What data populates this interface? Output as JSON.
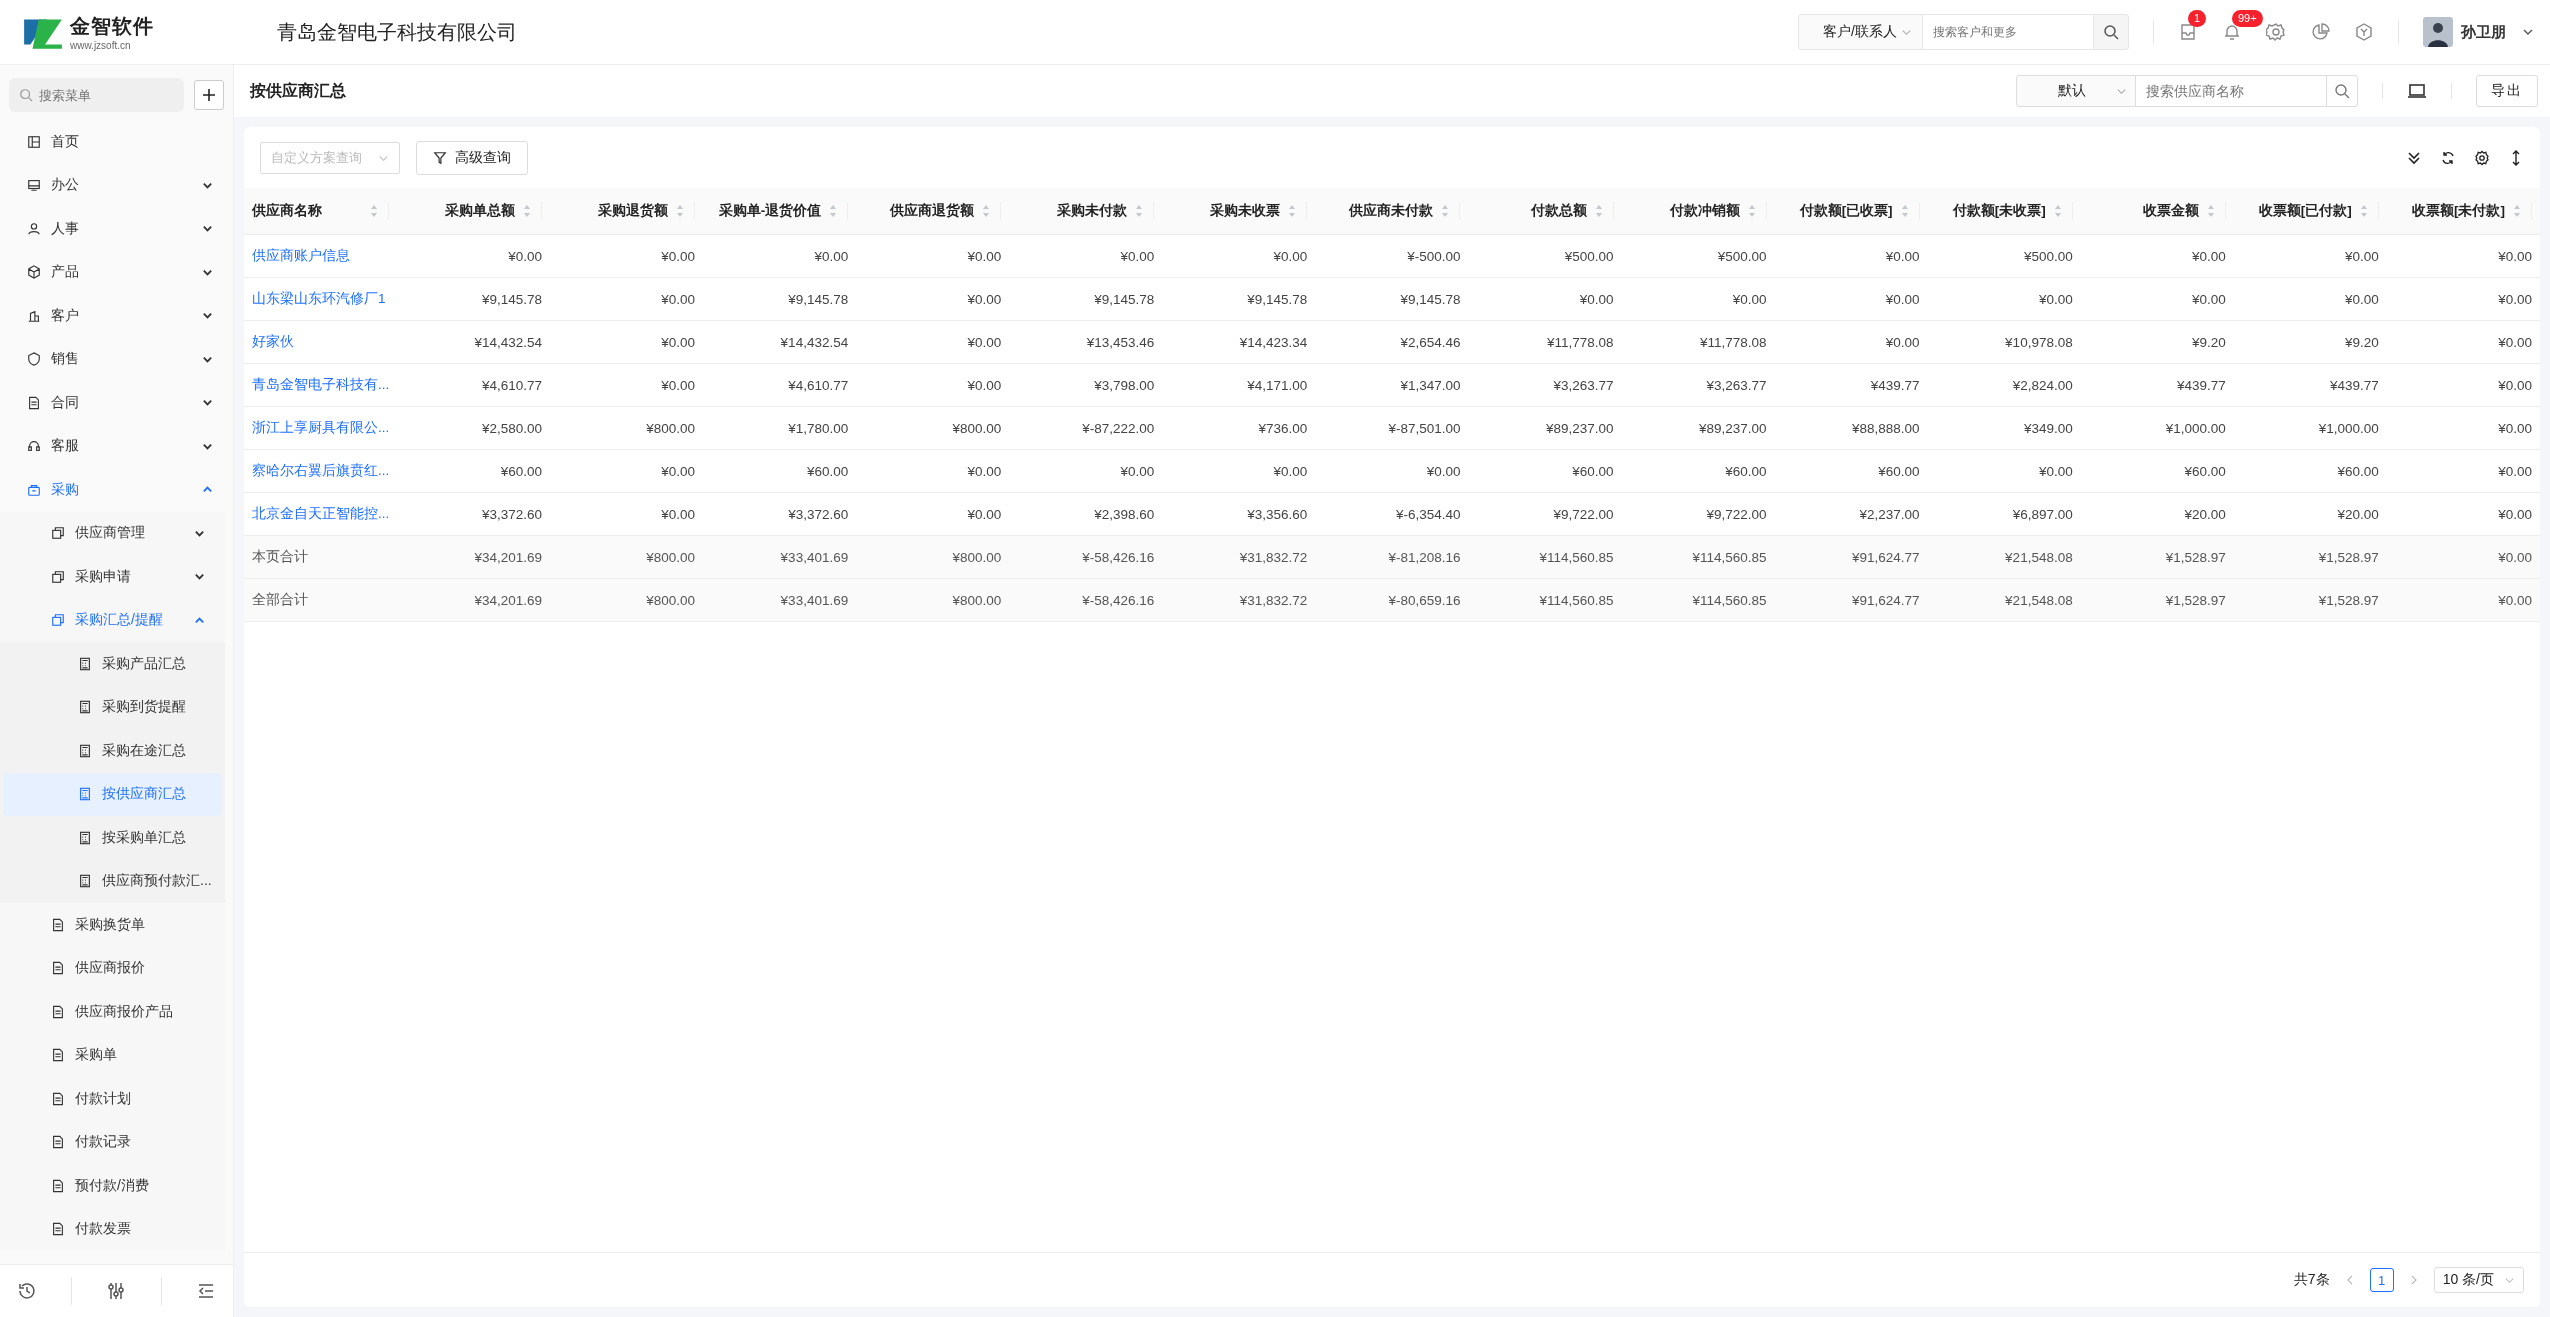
{
  "header": {
    "logo": {
      "name": "金智软件",
      "url": "www.jzsoft.cn"
    },
    "company": "青岛金智电子科技有限公司",
    "search": {
      "scope": "客户/联系人",
      "placeholder": "搜索客户和更多"
    },
    "badges": [
      "1",
      "99+"
    ],
    "user": "孙卫朋"
  },
  "sidebar": {
    "search": {
      "placeholder": "搜索菜单"
    },
    "items": [
      {
        "label": "首页",
        "kind": "link",
        "selected": false
      },
      {
        "label": "办公",
        "kind": "group",
        "expanded": false,
        "selected": false
      },
      {
        "label": "人事",
        "kind": "group",
        "expanded": false,
        "selected": false
      },
      {
        "label": "产品",
        "kind": "group",
        "expanded": false,
        "selected": false
      },
      {
        "label": "客户",
        "kind": "group",
        "expanded": false,
        "selected": false
      },
      {
        "label": "销售",
        "kind": "group",
        "expanded": false,
        "selected": false
      },
      {
        "label": "合同",
        "kind": "group",
        "expanded": false,
        "selected": false
      },
      {
        "label": "客服",
        "kind": "group",
        "expanded": false,
        "selected": false
      },
      {
        "label": "采购",
        "kind": "group",
        "expanded": true,
        "selected": false,
        "children": [
          {
            "label": "供应商管理",
            "kind": "group",
            "expanded": false,
            "selected": false
          },
          {
            "label": "采购申请",
            "kind": "group",
            "expanded": false,
            "selected": false
          },
          {
            "label": "采购汇总/提醒",
            "kind": "group",
            "expanded": true,
            "selected": false,
            "children": [
              {
                "label": "采购产品汇总",
                "kind": "link",
                "selected": false
              },
              {
                "label": "采购到货提醒",
                "kind": "link",
                "selected": false
              },
              {
                "label": "采购在途汇总",
                "kind": "link",
                "selected": false
              },
              {
                "label": "按供应商汇总",
                "kind": "link",
                "selected": true
              },
              {
                "label": "按采购单汇总",
                "kind": "link",
                "selected": false
              },
              {
                "label": "供应商预付款汇...",
                "kind": "link",
                "selected": false
              }
            ]
          },
          {
            "label": "采购换货单",
            "kind": "link",
            "selected": false
          },
          {
            "label": "供应商报价",
            "kind": "link",
            "selected": false
          },
          {
            "label": "供应商报价产品",
            "kind": "link",
            "selected": false
          },
          {
            "label": "采购单",
            "kind": "link",
            "selected": false
          },
          {
            "label": "付款计划",
            "kind": "link",
            "selected": false
          },
          {
            "label": "付款记录",
            "kind": "link",
            "selected": false
          },
          {
            "label": "预付款/消费",
            "kind": "link",
            "selected": false
          },
          {
            "label": "付款发票",
            "kind": "link",
            "selected": false
          }
        ]
      }
    ]
  },
  "page": {
    "title": "按供应商汇总",
    "view": "默认",
    "search": {
      "placeholder": "搜索供应商名称"
    },
    "export": "导出"
  },
  "filters": {
    "scheme": {
      "placeholder": "自定义方案查询"
    },
    "advanced": "高级查询"
  },
  "table": {
    "columns": [
      "供应商名称",
      "采购单总额",
      "采购退货额",
      "采购单-退货价值",
      "供应商退货额",
      "采购未付款",
      "采购未收票",
      "供应商未付款",
      "付款总额",
      "付款冲销额",
      "付款额[已收票]",
      "付款额[未收票]",
      "收票金额",
      "收票额[已付款]",
      "收票额[未付款]"
    ],
    "rows": [
      {
        "kind": "supplier",
        "cells": [
          "供应商账户信息",
          "¥0.00",
          "¥0.00",
          "¥0.00",
          "¥0.00",
          "¥0.00",
          "¥0.00",
          "¥-500.00",
          "¥500.00",
          "¥500.00",
          "¥0.00",
          "¥500.00",
          "¥0.00",
          "¥0.00",
          "¥0.00"
        ]
      },
      {
        "kind": "supplier",
        "cells": [
          "山东梁山东环汽修厂1",
          "¥9,145.78",
          "¥0.00",
          "¥9,145.78",
          "¥0.00",
          "¥9,145.78",
          "¥9,145.78",
          "¥9,145.78",
          "¥0.00",
          "¥0.00",
          "¥0.00",
          "¥0.00",
          "¥0.00",
          "¥0.00",
          "¥0.00"
        ]
      },
      {
        "kind": "supplier",
        "cells": [
          "好家伙",
          "¥14,432.54",
          "¥0.00",
          "¥14,432.54",
          "¥0.00",
          "¥13,453.46",
          "¥14,423.34",
          "¥2,654.46",
          "¥11,778.08",
          "¥11,778.08",
          "¥0.00",
          "¥10,978.08",
          "¥9.20",
          "¥9.20",
          "¥0.00"
        ]
      },
      {
        "kind": "supplier",
        "cells": [
          "青岛金智电子科技有...",
          "¥4,610.77",
          "¥0.00",
          "¥4,610.77",
          "¥0.00",
          "¥3,798.00",
          "¥4,171.00",
          "¥1,347.00",
          "¥3,263.77",
          "¥3,263.77",
          "¥439.77",
          "¥2,824.00",
          "¥439.77",
          "¥439.77",
          "¥0.00"
        ]
      },
      {
        "kind": "supplier",
        "cells": [
          "浙江上享厨具有限公...",
          "¥2,580.00",
          "¥800.00",
          "¥1,780.00",
          "¥800.00",
          "¥-87,222.00",
          "¥736.00",
          "¥-87,501.00",
          "¥89,237.00",
          "¥89,237.00",
          "¥88,888.00",
          "¥349.00",
          "¥1,000.00",
          "¥1,000.00",
          "¥0.00"
        ]
      },
      {
        "kind": "supplier",
        "cells": [
          "察哈尔右翼后旗贲红...",
          "¥60.00",
          "¥0.00",
          "¥60.00",
          "¥0.00",
          "¥0.00",
          "¥0.00",
          "¥0.00",
          "¥60.00",
          "¥60.00",
          "¥60.00",
          "¥0.00",
          "¥60.00",
          "¥60.00",
          "¥0.00"
        ]
      },
      {
        "kind": "supplier",
        "cells": [
          "北京金自天正智能控...",
          "¥3,372.60",
          "¥0.00",
          "¥3,372.60",
          "¥0.00",
          "¥2,398.60",
          "¥3,356.60",
          "¥-6,354.40",
          "¥9,722.00",
          "¥9,722.00",
          "¥2,237.00",
          "¥6,897.00",
          "¥20.00",
          "¥20.00",
          "¥0.00"
        ]
      },
      {
        "kind": "total",
        "cells": [
          "本页合计",
          "¥34,201.69",
          "¥800.00",
          "¥33,401.69",
          "¥800.00",
          "¥-58,426.16",
          "¥31,832.72",
          "¥-81,208.16",
          "¥114,560.85",
          "¥114,560.85",
          "¥91,624.77",
          "¥21,548.08",
          "¥1,528.97",
          "¥1,528.97",
          "¥0.00"
        ]
      },
      {
        "kind": "total",
        "cells": [
          "全部合计",
          "¥34,201.69",
          "¥800.00",
          "¥33,401.69",
          "¥800.00",
          "¥-58,426.16",
          "¥31,832.72",
          "¥-80,659.16",
          "¥114,560.85",
          "¥114,560.85",
          "¥91,624.77",
          "¥21,548.08",
          "¥1,528.97",
          "¥1,528.97",
          "¥0.00"
        ]
      }
    ]
  },
  "pagination": {
    "total": "共7条",
    "pages": [
      {
        "label": "1",
        "selected": true
      }
    ],
    "page_size": "10 条/页"
  }
}
